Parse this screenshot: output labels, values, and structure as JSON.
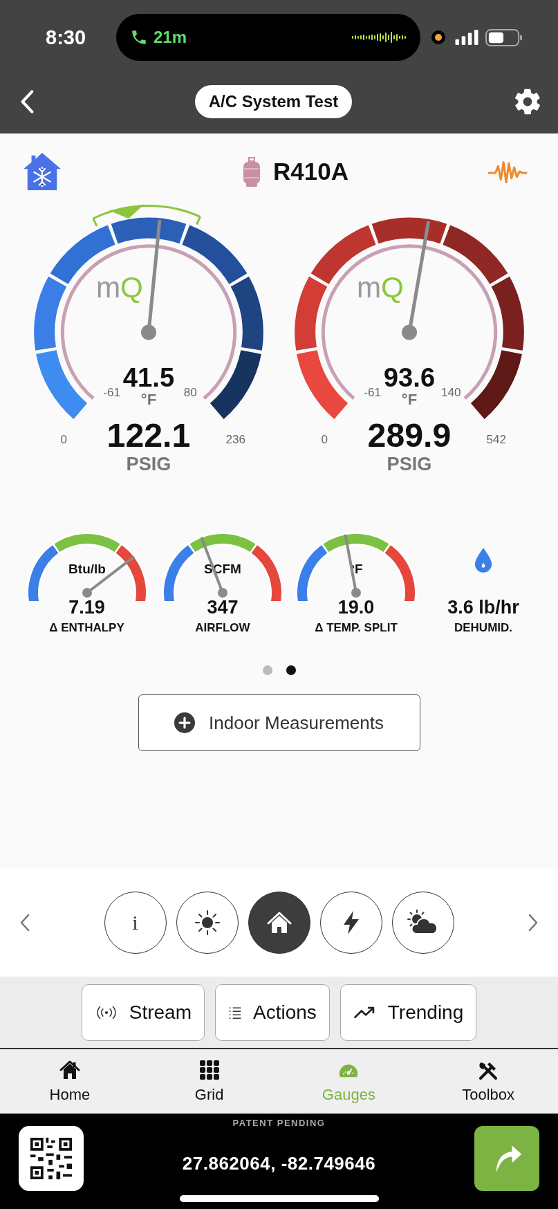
{
  "status_bar": {
    "time": "8:30",
    "call_duration": "21m"
  },
  "header": {
    "title": "A/C System Test"
  },
  "refrigerant": {
    "name": "R410A"
  },
  "gauges": [
    {
      "kind": "low",
      "logo": [
        "m",
        "Q"
      ],
      "target": true,
      "temperature": "41.5",
      "temperature_unit": "°F",
      "temp_min": "-61",
      "temp_max": "80",
      "pressure": "122.1",
      "pressure_unit": "PSIG",
      "pressure_min": "0",
      "pressure_max": "236"
    },
    {
      "kind": "high",
      "logo": [
        "m",
        "Q"
      ],
      "target": false,
      "temperature": "93.6",
      "temperature_unit": "°F",
      "temp_min": "-61",
      "temp_max": "140",
      "pressure": "289.9",
      "pressure_unit": "PSIG",
      "pressure_min": "0",
      "pressure_max": "542"
    }
  ],
  "meters": [
    {
      "kind": "gauge",
      "unit": "Btu/lb",
      "value": "7.19",
      "label": "Δ ENTHALPY"
    },
    {
      "kind": "gauge",
      "unit": "SCFM",
      "value": "347",
      "label": "AIRFLOW"
    },
    {
      "kind": "gauge",
      "unit": "°F",
      "value": "19.0",
      "label": "Δ TEMP. SPLIT"
    },
    {
      "kind": "readout",
      "value": "3.6 lb/hr",
      "label": "DEHUMID."
    }
  ],
  "pager": [
    {
      "selected": false
    },
    {
      "selected": true
    }
  ],
  "indoor_button": {
    "label": "Indoor Measurements"
  },
  "modes": [
    {
      "kind": "info",
      "glyph": "i",
      "selected": false
    },
    {
      "kind": "sun",
      "selected": false
    },
    {
      "kind": "home",
      "selected": true
    },
    {
      "kind": "power",
      "selected": false
    },
    {
      "kind": "weather",
      "selected": false
    }
  ],
  "actions": [
    {
      "kind": "stream",
      "label": "Stream"
    },
    {
      "kind": "list",
      "label": "Actions"
    },
    {
      "kind": "trend",
      "label": "Trending"
    }
  ],
  "tabs": [
    {
      "kind": "home",
      "label": "Home",
      "selected": false
    },
    {
      "kind": "grid",
      "label": "Grid",
      "selected": false
    },
    {
      "kind": "gauge",
      "label": "Gauges",
      "selected": true
    },
    {
      "kind": "tools",
      "label": "Toolbox",
      "selected": false
    }
  ],
  "footer": {
    "notice": "PATENT PENDING",
    "coordinates": "27.862064, -82.749646"
  }
}
